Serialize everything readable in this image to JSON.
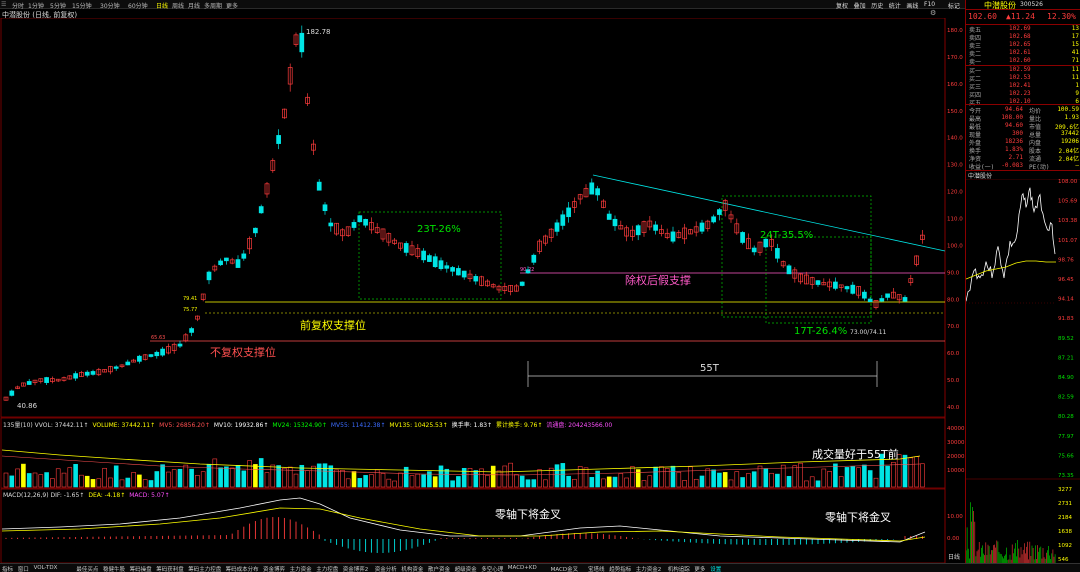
{
  "top_tabs": [
    "分时",
    "1分钟",
    "5分钟",
    "15分钟",
    "30分钟",
    "60分钟",
    "日线",
    "周线",
    "月线",
    "多周期",
    "更多"
  ],
  "top_tabs_active": 6,
  "top_tools": [
    "复权",
    "叠加",
    "历史",
    "统计",
    "画线",
    "F10",
    "标记",
    "+自选",
    "返回"
  ],
  "chart_title": "中潜股份 (日线, 前复权)",
  "stock": {
    "name": "中潜股份",
    "code": "300526",
    "price": "102.60",
    "change": "▲11.24",
    "pct": "12.30%"
  },
  "asks": [
    {
      "label": "卖五",
      "price": "102.69",
      "vol": "13"
    },
    {
      "label": "卖四",
      "price": "102.68",
      "vol": "17"
    },
    {
      "label": "卖三",
      "price": "102.65",
      "vol": "15"
    },
    {
      "label": "卖二",
      "price": "102.61",
      "vol": "41"
    },
    {
      "label": "卖一",
      "price": "102.60",
      "vol": "71"
    }
  ],
  "bids": [
    {
      "label": "买一",
      "price": "102.59",
      "vol": "11"
    },
    {
      "label": "买二",
      "price": "102.53",
      "vol": "11"
    },
    {
      "label": "买三",
      "price": "102.41",
      "vol": "1"
    },
    {
      "label": "买四",
      "price": "102.23",
      "vol": "9"
    },
    {
      "label": "买五",
      "price": "102.10",
      "vol": "6"
    }
  ],
  "stats": [
    {
      "a": "今开",
      "b": "94.64",
      "c": "均价",
      "d": "100.59"
    },
    {
      "a": "最高",
      "b": "108.00",
      "c": "量比",
      "d": "1.93"
    },
    {
      "a": "最低",
      "b": "94.60",
      "c": "市值",
      "d": "209.6亿"
    },
    {
      "a": "现量",
      "b": "300",
      "c": "总量",
      "d": "37442"
    },
    {
      "a": "外盘",
      "b": "18236",
      "c": "内盘",
      "d": "19206"
    },
    {
      "a": "换手",
      "b": "1.83%",
      "c": "股本",
      "d": "2.04亿"
    },
    {
      "a": "净资",
      "b": "2.71",
      "c": "流通",
      "d": "2.04亿"
    },
    {
      "a": "收益(一)",
      "b": "-0.083",
      "c": "PE(动)",
      "d": "—"
    }
  ],
  "mini_title": "中潜股份",
  "mini_axis": [
    "108.00",
    "105.69",
    "103.38",
    "101.07",
    "98.76",
    "96.45",
    "94.14",
    "91.83",
    "89.52",
    "87.21",
    "84.90",
    "82.59",
    "80.28",
    "77.97",
    "75.66",
    "73.35"
  ],
  "mini_vol_axis": [
    "3277",
    "2731",
    "2184",
    "1638",
    "1092",
    "546"
  ],
  "price_axis": [
    "180.0",
    "170.0",
    "160.0",
    "150.0",
    "140.0",
    "130.0",
    "120.0",
    "110.0",
    "100.0",
    "90.0",
    "80.0",
    "70.0",
    "60.0",
    "50.0",
    "40.0"
  ],
  "vol_axis": [
    "40000",
    "30000",
    "20000",
    "10000"
  ],
  "macd_axis": [
    "10.00",
    "0.00"
  ],
  "price_labels": {
    "high": "182.78",
    "low": "40.86",
    "low2": "73.00/74.11"
  },
  "level_labels": {
    "l1": "79.41",
    "l2": "75.77",
    "l3": "65.63",
    "l4": "90.22"
  },
  "annotations": {
    "a1": "23T-26%",
    "a2": "24T-35.5%",
    "a3": "17T-26.4%",
    "support1": "除权后假支撑",
    "support2": "前复权支撑位",
    "support3": "不复权支撑位",
    "span": "55T",
    "vol_note": "成交量好于55T前",
    "macd1": "零轴下将金叉",
    "macd2": "零轴下将金叉"
  },
  "vol_header": [
    {
      "t": "135量(10) VVOL: 37442.11↑",
      "c": "#dddddd"
    },
    {
      "t": "VOLUME: 37442.11↑",
      "c": "#ffff00"
    },
    {
      "t": "MV5: 26856.20↑",
      "c": "#ff5050"
    },
    {
      "t": "MV10: 19932.86↑",
      "c": "#ffffff"
    },
    {
      "t": "MV24: 15324.90↑",
      "c": "#00ff00"
    },
    {
      "t": "MV55: 11412.38↑",
      "c": "#3c6cff"
    },
    {
      "t": "MV135: 10425.53↑",
      "c": "#ffff00"
    },
    {
      "t": "换手率: 1.83↑",
      "c": "#ffffff"
    },
    {
      "t": "累计换手: 9.76↑",
      "c": "#ffff00"
    },
    {
      "t": "流通盘: 204243566.00",
      "c": "#ff50ff"
    }
  ],
  "macd_header": [
    {
      "t": "MACD(12,26,9) DIF: -1.65↑",
      "c": "#dddddd"
    },
    {
      "t": "DEA: -4.18↑",
      "c": "#ffff00"
    },
    {
      "t": "MACD: 5.07↑",
      "c": "#ff50ff"
    }
  ],
  "bottom_tabs": [
    "指标",
    "窗口",
    "VOL-TDX",
    "最佳买点",
    "稳健牛股",
    "筹码操盘",
    "筹码获利盘",
    "筹码主力控盘",
    "筹码成本分布",
    "资金博弈",
    "主力资金",
    "主力控盘",
    "资金博弈2",
    "资金分析",
    "机构资金",
    "散户资金",
    "超级资金",
    "多空心理",
    "MACD+KD",
    "MACD金叉",
    "宝塔线",
    "趋势指标",
    "主力资金2",
    "机构追踪",
    "更多"
  ],
  "bottom_active": 25,
  "bottom_active_label": "设置",
  "right_bottom": [
    "日线",
    "模板"
  ],
  "colors": {
    "up": "#ff3c3c",
    "down": "#00e5e5",
    "ma": "#ffff00",
    "bg": "#000000"
  }
}
